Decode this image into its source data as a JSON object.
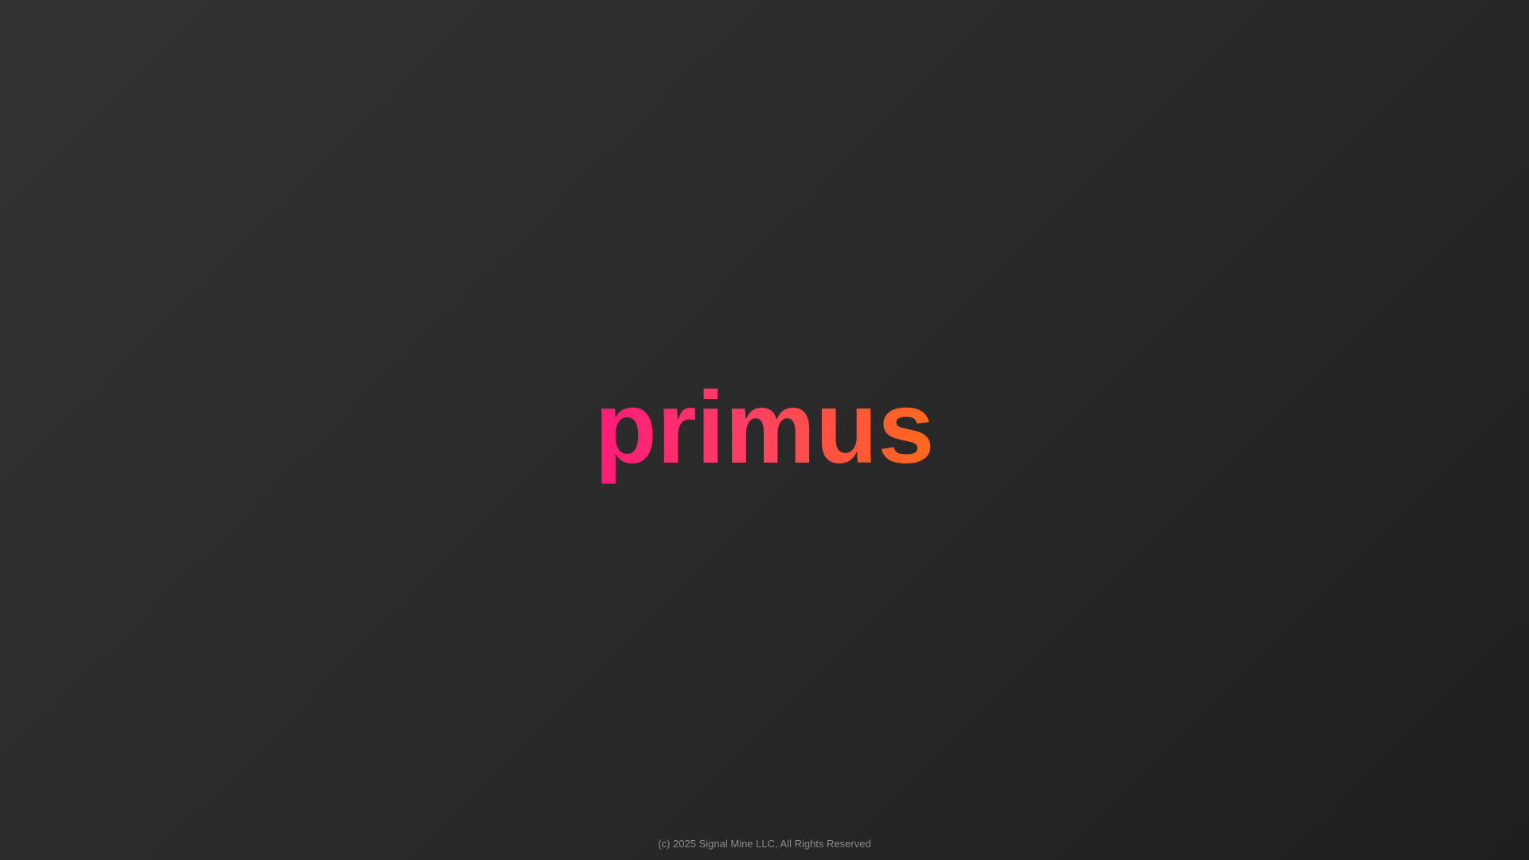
{
  "app": {
    "logo_text": "primus"
  },
  "footer": {
    "copyright": "(c) 2025 Signal Mine LLC, All Rights Reserved"
  },
  "colors": {
    "background_start": "#333333",
    "background_end": "#1f1f1f",
    "logo_gradient_start": "#ff1a7a",
    "logo_gradient_end": "#ff6a1a",
    "footer_text": "#8a8a8a"
  }
}
